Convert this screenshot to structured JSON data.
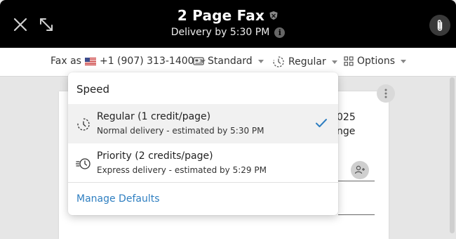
{
  "header": {
    "title": "2 Page Fax",
    "subtitle": "Delivery by 5:30 PM"
  },
  "toolbar": {
    "fax_as_label": "Fax as",
    "fax_number": "+1 (907) 313-1400",
    "quality": "Standard",
    "speed": "Regular",
    "options": "Options"
  },
  "document": {
    "fragment_1": "025",
    "fragment_2": "nge"
  },
  "speed_menu": {
    "header": "Speed",
    "options": [
      {
        "label": "Regular (1 credit/page)",
        "description": "Normal delivery - estimated by 5:30 PM",
        "selected": true
      },
      {
        "label": "Priority (2 credits/page)",
        "description": "Express delivery - estimated by 5:29 PM",
        "selected": false
      }
    ],
    "manage_link": "Manage Defaults"
  },
  "colors": {
    "header_bg": "#000000",
    "link": "#2f7fc1",
    "check": "#2f7fc1",
    "selected_row": "#f1f1f1"
  },
  "icons": {
    "close": "close-icon",
    "expand": "expand-icon",
    "shield": "shield-icon",
    "info": "info-icon",
    "attach": "paperclip-icon",
    "flag": "us-flag-icon",
    "quality": "document-quality-icon",
    "speed": "speed-clock-icon",
    "options": "grid-options-icon",
    "priority": "fast-clock-icon",
    "check": "checkmark-icon",
    "more": "more-vertical-icon",
    "contact": "add-contact-icon"
  }
}
